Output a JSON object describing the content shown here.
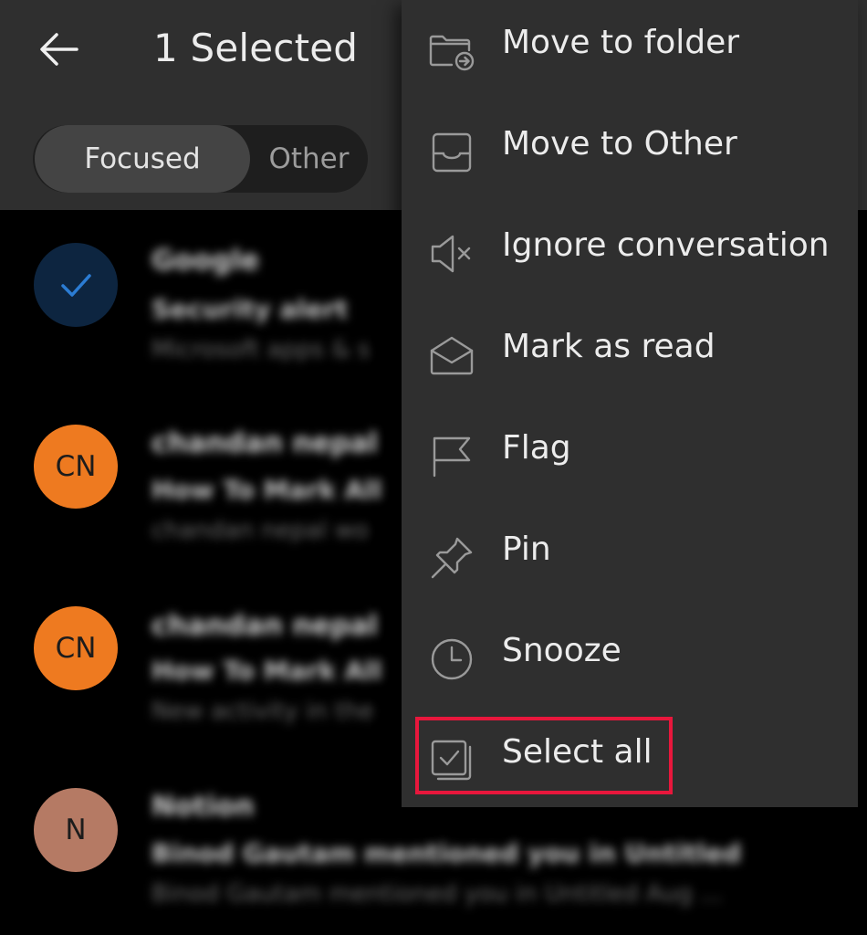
{
  "header": {
    "title": "1 Selected",
    "tabs": [
      {
        "label": "Focused",
        "active": true
      },
      {
        "label": "Other",
        "active": false
      }
    ]
  },
  "mail_list": [
    {
      "avatar": "",
      "selected": true,
      "sender": "Google",
      "subject": "Security alert",
      "preview": "Microsoft apps & s"
    },
    {
      "avatar": "CN",
      "selected": false,
      "sender": "chandan nepal",
      "subject": "How To Mark All",
      "preview": "chandan nepal wo"
    },
    {
      "avatar": "CN",
      "selected": false,
      "sender": "chandan nepal",
      "subject": "How To Mark All",
      "preview": "New activity in the"
    },
    {
      "avatar": "N",
      "selected": false,
      "sender": "Notion",
      "subject": "Binod Gautam mentioned you in Untitled",
      "preview": "Binod Gautam mentioned you in Untitled Aug ..."
    }
  ],
  "menu": {
    "items": [
      {
        "label": "Move to folder",
        "icon": "folder-move-icon"
      },
      {
        "label": "Move to Other",
        "icon": "inbox-tray-icon"
      },
      {
        "label": "Ignore conversation",
        "icon": "speaker-mute-icon"
      },
      {
        "label": "Mark as read",
        "icon": "envelope-open-icon"
      },
      {
        "label": "Flag",
        "icon": "flag-icon"
      },
      {
        "label": "Pin",
        "icon": "pin-icon"
      },
      {
        "label": "Snooze",
        "icon": "clock-icon"
      },
      {
        "label": "Select all",
        "icon": "select-all-icon",
        "highlighted": true
      }
    ]
  },
  "colors": {
    "highlight": "#e8173c",
    "avatar_orange": "#ee7a20",
    "avatar_brown": "#b57a64",
    "check_blue": "#2b7cd3"
  }
}
